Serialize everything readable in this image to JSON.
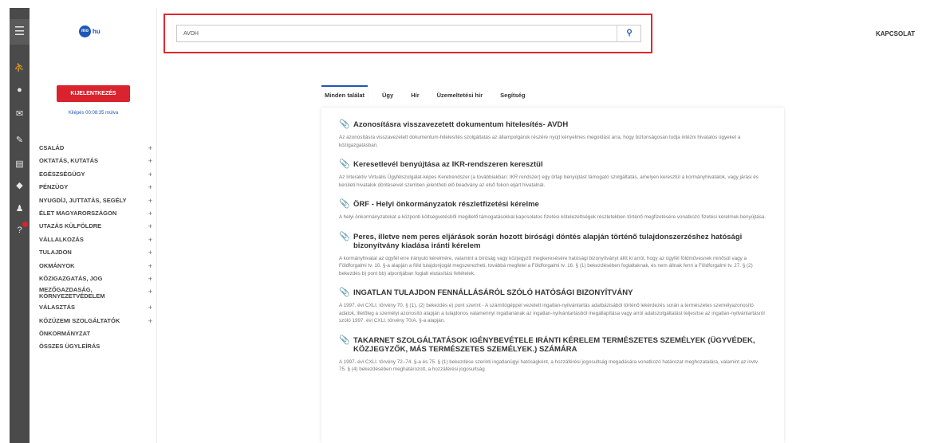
{
  "rail": {
    "icons": [
      "menu-icon",
      "person-icon",
      "user-icon",
      "mail-icon",
      "wrench-icon",
      "id-card-icon",
      "shield-icon",
      "users-icon",
      "help-icon"
    ]
  },
  "logo": {
    "circle": "mo",
    "suffix": "hu"
  },
  "session": {
    "logout_label": "KIJELENTKEZÉS",
    "countdown": "Kilépés 00:08:35 múlva"
  },
  "nav": [
    {
      "label": "CSALÁD",
      "expand": "+"
    },
    {
      "label": "OKTATÁS, KUTATÁS",
      "expand": "+"
    },
    {
      "label": "EGÉSZSÉGÜGY",
      "expand": "+"
    },
    {
      "label": "PÉNZÜGY",
      "expand": "+"
    },
    {
      "label": "NYUGDÍJ, JUTTATÁS, SEGÉLY",
      "expand": "+"
    },
    {
      "label": "ÉLET MAGYARORSZÁGON",
      "expand": "+"
    },
    {
      "label": "UTAZÁS KÜLFÖLDRE",
      "expand": "+"
    },
    {
      "label": "VÁLLALKOZÁS",
      "expand": "+"
    },
    {
      "label": "TULAJDON",
      "expand": "+"
    },
    {
      "label": "OKMÁNYOK",
      "expand": "+"
    },
    {
      "label": "KÖZIGAZGATÁS, JOG",
      "expand": "+"
    },
    {
      "label": "MEZŐGAZDASÁG, KÖRNYEZETVÉDELEM",
      "expand": "+"
    },
    {
      "label": "VÁLASZTÁS",
      "expand": "+"
    },
    {
      "label": "KÖZÜZEMI SZOLGÁLTATÓK",
      "expand": "+"
    },
    {
      "label": "ÖNKORMÁNYZAT",
      "expand": ""
    },
    {
      "label": "ÖSSZES ÜGYLEÍRÁS",
      "expand": ""
    }
  ],
  "search": {
    "value": "AVDH",
    "button_icon": "search-icon"
  },
  "header": {
    "contact": "KAPCSOLAT"
  },
  "tabs": [
    {
      "label": "Minden találat",
      "active": true
    },
    {
      "label": "Ügy",
      "active": false
    },
    {
      "label": "Hír",
      "active": false
    },
    {
      "label": "Üzemeltetési hír",
      "active": false
    },
    {
      "label": "Segítség",
      "active": false
    }
  ],
  "results": [
    {
      "title": "Azonosításra visszavezetett dokumentum hitelesítés- AVDH",
      "desc": "Az azonosításra visszavezetett dokumentum-hitelesítés szolgáltatás az állampolgárok részére nyújt kényelmes megoldást arra, hogy biztonságosan tudja intézni hivatalos ügyeket a közigazgatásban."
    },
    {
      "title": "Keresetlevél benyújtása az IKR-rendszeren keresztül",
      "desc": "Az Interaktív Virtuális Ügyfélszolgálat-képes Keretrendszer (a továbbiakban: IKR rendszer) egy űrlap benyújtást támogató szolgáltatás, amelyen keresztül a kormányhivatalok, vagy járási és kerületi hivatalok döntéseivel szemben jelentheti elő beadvány az első fokon eljárt hivatalnál."
    },
    {
      "title": "ÖRF - Helyi önkormányzatok részletfizetési kérelme",
      "desc": "A helyi önkormányzatokat a központi költségvetésből megillető támogatásokkal kapcsolatos fizetési kötelezettségek részletekben történő megfizetésére vonatkozó fizetési kérelmek benyújtása."
    },
    {
      "title": "Peres, illetve nem peres eljárások során hozott bírósági döntés alapján történő tulajdonszerzéshez hatósági bizonyítvány kiadása iránti kérelem",
      "desc": "A kormányhivatal az ügyfél erre irányuló kérelmére, valamint a bíróság vagy közjegyző megkeresésére hatósági bizonyítványt állít ki arról, hogy az ügyfél földművesnek minősül vagy a Földforgalmi tv. 10. §-a alapján a föld tulajdonjogát megszerezheti, továbbá megfelel a Földforgalmi tv. 16. § (1) bekezdésében foglaltaknak, és nem állnak fenn a Földforgalmi tv. 27. § (2) bekezdés b) pont bb) alpontjában foglalt elutasítási feltételek."
    },
    {
      "title": "INGATLAN TULAJDON FENNÁLLÁSÁRÓL SZÓLÓ HATÓSÁGI BIZONYÍTVÁNY",
      "desc": "A 1997. évi CXLI. törvény 70. § (1), (2) bekezdés e) pont szerint - A számítógéppel vezetett ingatlan-nyilvántartás adatbázisából történő lekérdezés során a természetes személyazonosító adatok, illetőleg a személyi azonosító alapján a tulajdonos valamennyi ingatlanának az ingatlan-nyilvántartásból megállapítása vagy arról adatszolgáltatást teljesítse az ingatlan-nyilvántartásról szóló 1997. évi CXLI. törvény 70/A. §-a alapján."
    },
    {
      "title": "TAKARNET SZOLGÁLTATÁSOK IGÉNYBEVÉTELE IRÁNTI KÉRELEM TERMÉSZETES SZEMÉLYEK (ÜGYVÉDEK, KÖZJEGYZŐK, MÁS TERMÉSZETES SZEMÉLYEK.) SZÁMÁRA",
      "desc": "A 1997. évi CXLI. törvény 72–74. §-a és 75. § (1) bekezdése szerinti ingatlanügyi hatóságként, a hozzáférési jogosultság megadására vonatkozó határozat meghozatalára, valamint az invtv. 75. § (4) bekezdésében meghatározott, a hozzáférési jogosultság"
    }
  ]
}
